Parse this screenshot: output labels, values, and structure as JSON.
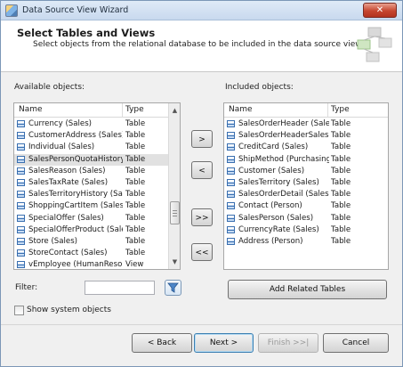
{
  "window": {
    "title": "Data Source View Wizard",
    "close_label": "✕"
  },
  "header": {
    "title": "Select Tables and Views",
    "subtitle": "Select objects from the relational database to be included in the data source view."
  },
  "available": {
    "label": "Available objects:",
    "columns": [
      "Name",
      "Type"
    ],
    "rows": [
      {
        "name": "Currency (Sales)",
        "type": "Table"
      },
      {
        "name": "CustomerAddress (Sales)",
        "type": "Table"
      },
      {
        "name": "Individual (Sales)",
        "type": "Table"
      },
      {
        "name": "SalesPersonQuotaHistory ...",
        "type": "Table"
      },
      {
        "name": "SalesReason (Sales)",
        "type": "Table"
      },
      {
        "name": "SalesTaxRate (Sales)",
        "type": "Table"
      },
      {
        "name": "SalesTerritoryHistory (Sales)",
        "type": "Table"
      },
      {
        "name": "ShoppingCartItem (Sales)",
        "type": "Table"
      },
      {
        "name": "SpecialOffer (Sales)",
        "type": "Table"
      },
      {
        "name": "SpecialOfferProduct (Sales)",
        "type": "Table"
      },
      {
        "name": "Store (Sales)",
        "type": "Table"
      },
      {
        "name": "StoreContact (Sales)",
        "type": "Table"
      },
      {
        "name": "vEmployee (HumanResou...",
        "type": "View"
      }
    ],
    "selected_row": "SalesPersonQuotaHistory ..."
  },
  "included": {
    "label": "Included objects:",
    "columns": [
      "Name",
      "Type"
    ],
    "rows": [
      {
        "name": "SalesOrderHeader (Sales)",
        "type": "Table"
      },
      {
        "name": "SalesOrderHeaderSalesRe...",
        "type": "Table"
      },
      {
        "name": "CreditCard (Sales)",
        "type": "Table"
      },
      {
        "name": "ShipMethod (Purchasing)",
        "type": "Table"
      },
      {
        "name": "Customer (Sales)",
        "type": "Table"
      },
      {
        "name": "SalesTerritory (Sales)",
        "type": "Table"
      },
      {
        "name": "SalesOrderDetail (Sales)",
        "type": "Table"
      },
      {
        "name": "Contact (Person)",
        "type": "Table"
      },
      {
        "name": "SalesPerson (Sales)",
        "type": "Table"
      },
      {
        "name": "CurrencyRate (Sales)",
        "type": "Table"
      },
      {
        "name": "Address (Person)",
        "type": "Table"
      }
    ]
  },
  "transfer": {
    "add_one": ">",
    "remove_one": "<",
    "add_all": ">>",
    "remove_all": "<<"
  },
  "filter": {
    "label": "Filter:",
    "value": ""
  },
  "add_related_label": "Add Related Tables",
  "show_system_label": "Show system objects",
  "show_system_checked": false,
  "footer": {
    "back": "< Back",
    "next": "Next >",
    "finish": "Finish >>|",
    "cancel": "Cancel"
  },
  "icons": {
    "table": "table-icon",
    "view": "view-icon",
    "filter": "funnel-icon"
  },
  "colors": {
    "selection": "#e1e1e1",
    "focus_border": "#3c7fb1",
    "close_button": "#c6462f"
  }
}
